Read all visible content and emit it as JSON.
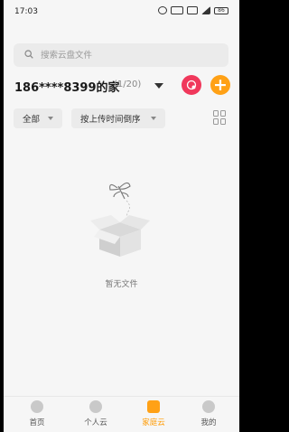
{
  "status": {
    "time": "17:03",
    "battery": "86"
  },
  "search": {
    "placeholder": "搜索云盘文件"
  },
  "family": {
    "title": "186****8399的家",
    "count": "(1/20)",
    "add_symbol": "+"
  },
  "filters": {
    "category": "全部",
    "sort": "按上传时间倒序"
  },
  "empty": {
    "text": "暂无文件"
  },
  "nav": [
    {
      "label": "首页",
      "icon": "home-icon"
    },
    {
      "label": "个人云",
      "icon": "cloud-icon"
    },
    {
      "label": "家庭云",
      "icon": "family-cloud-icon"
    },
    {
      "label": "我的",
      "icon": "profile-icon"
    }
  ],
  "colors": {
    "accent": "#ffa116",
    "red": "#f0385b"
  }
}
